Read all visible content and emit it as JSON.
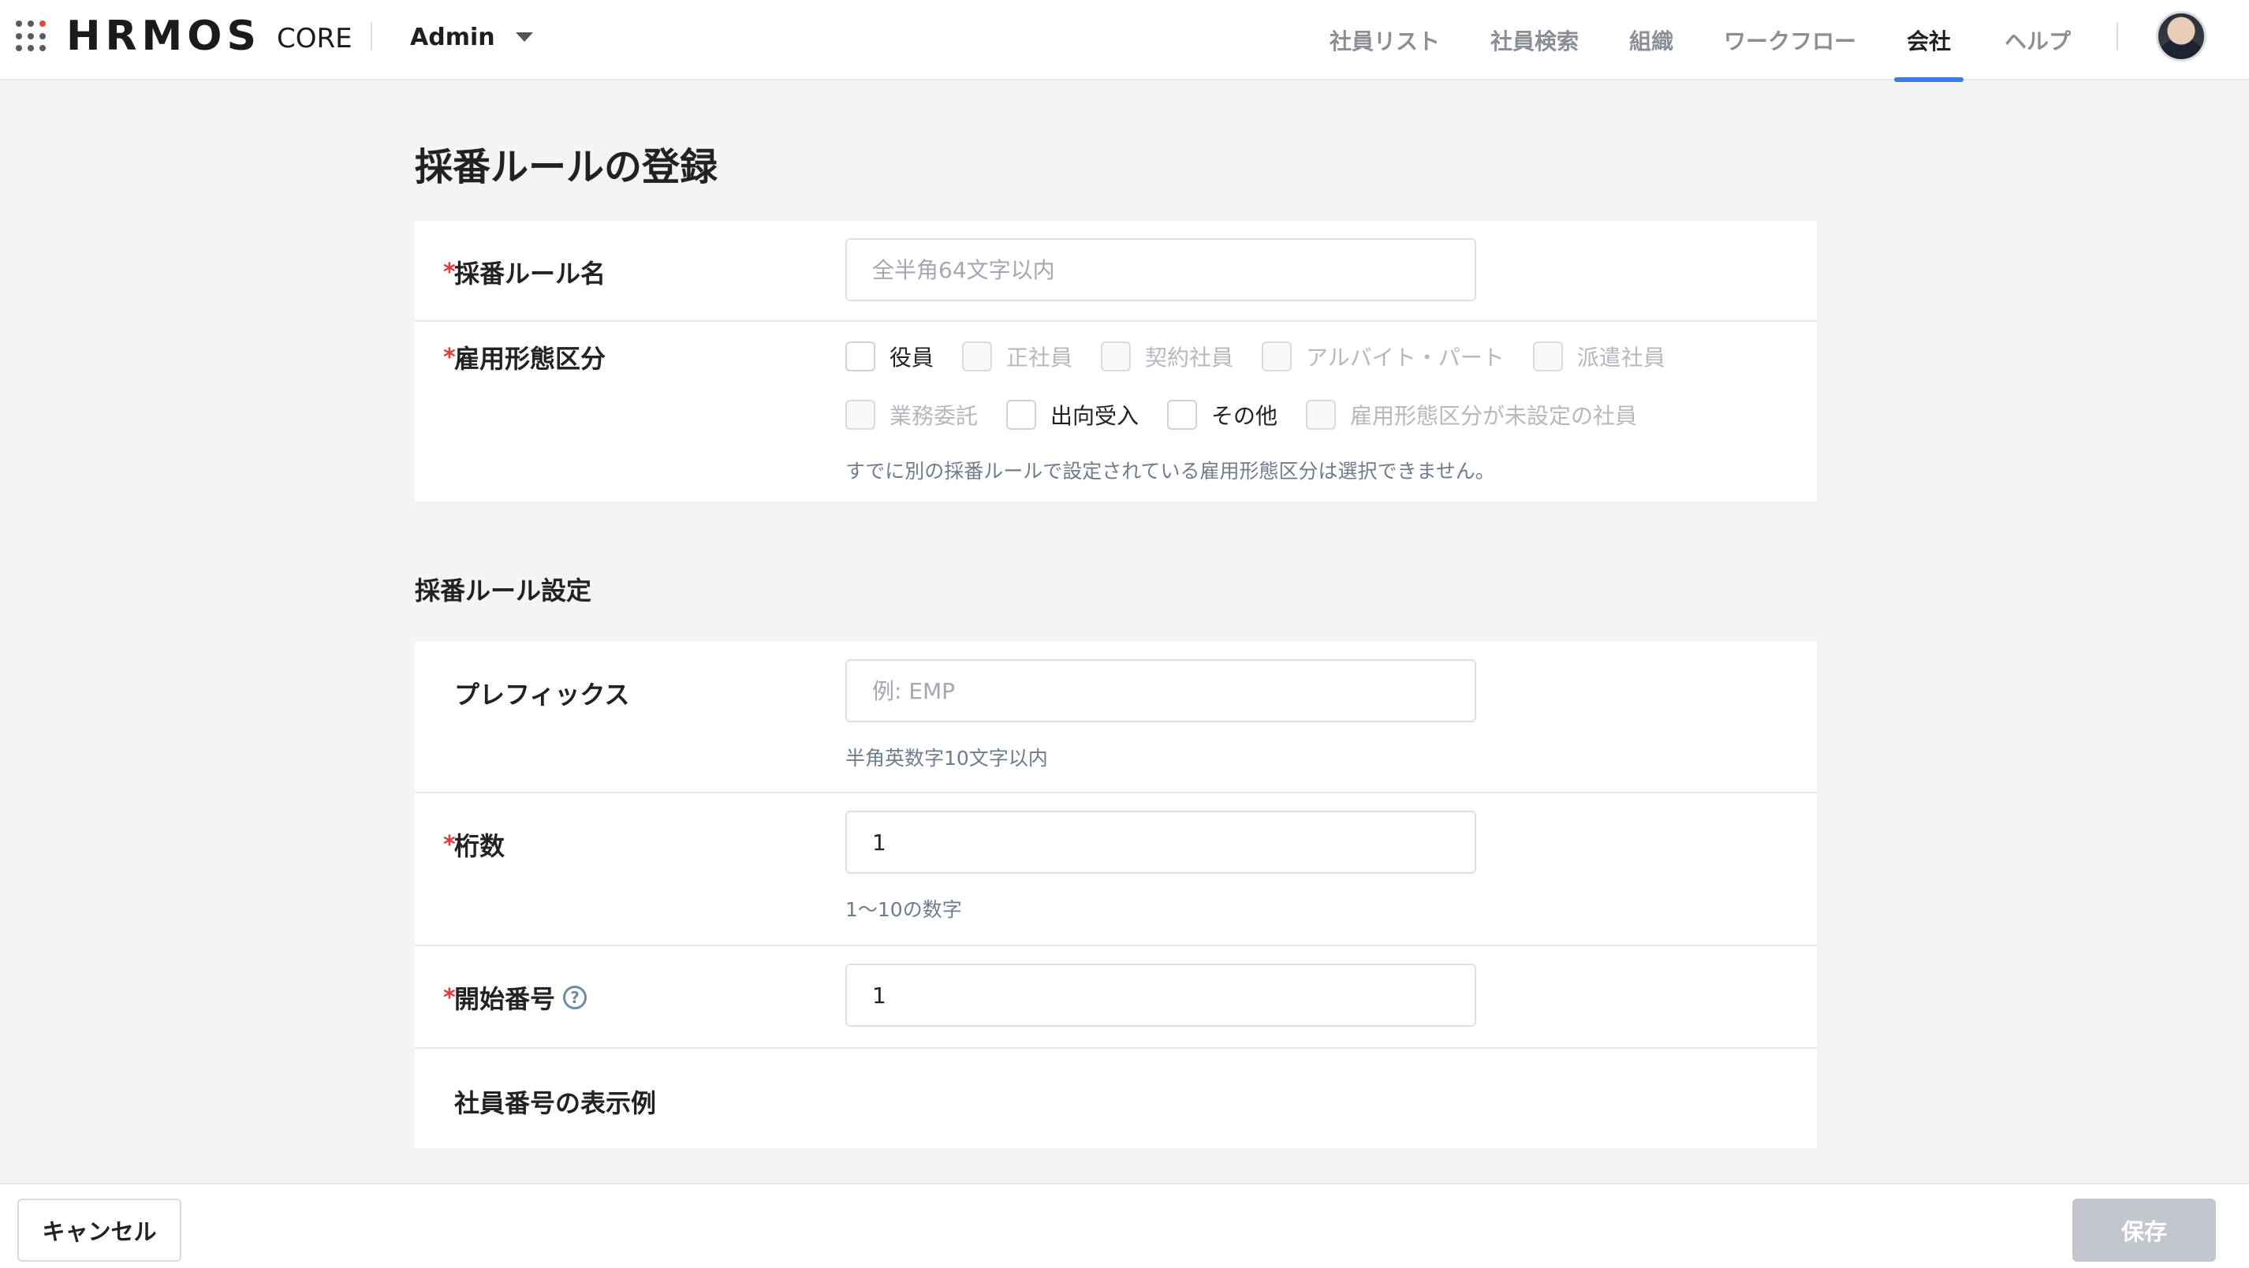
{
  "header": {
    "logo_text": "HRMOS",
    "logo_sub": "CORE",
    "account_label": "Admin",
    "nav": [
      {
        "label": "社員リスト"
      },
      {
        "label": "社員検索"
      },
      {
        "label": "組織"
      },
      {
        "label": "ワークフロー"
      },
      {
        "label": "会社",
        "active": true
      },
      {
        "label": "ヘルプ"
      }
    ],
    "active_color": "#3a7fe0"
  },
  "page": {
    "title": "採番ルールの登録"
  },
  "form_basic": {
    "rule_name": {
      "label": "採番ルール名",
      "required": true,
      "placeholder": "全半角64文字以内",
      "value": ""
    },
    "employment_type": {
      "label": "雇用形態区分",
      "required": true,
      "options": [
        {
          "label": "役員",
          "enabled": true,
          "checked": false
        },
        {
          "label": "正社員",
          "enabled": false,
          "checked": false
        },
        {
          "label": "契約社員",
          "enabled": false,
          "checked": false
        },
        {
          "label": "アルバイト・パート",
          "enabled": false,
          "checked": false
        },
        {
          "label": "派遣社員",
          "enabled": false,
          "checked": false
        },
        {
          "label": "業務委託",
          "enabled": false,
          "checked": false
        },
        {
          "label": "出向受入",
          "enabled": true,
          "checked": false
        },
        {
          "label": "その他",
          "enabled": true,
          "checked": false
        },
        {
          "label": "雇用形態区分が未設定の社員",
          "enabled": false,
          "checked": false
        }
      ],
      "note": "すでに別の採番ルールで設定されている雇用形態区分は選択できません。"
    }
  },
  "section_settings": {
    "title": "採番ルール設定",
    "prefix": {
      "label": "プレフィックス",
      "placeholder": "例: EMP",
      "value": "",
      "hint": "半角英数字10文字以内"
    },
    "digits": {
      "label": "桁数",
      "required": true,
      "value": "1",
      "hint": "1〜10の数字"
    },
    "start_number": {
      "label": "開始番号",
      "required": true,
      "value": "1",
      "help_icon": "question-circle-icon"
    },
    "preview": {
      "label": "社員番号の表示例"
    }
  },
  "footer": {
    "cancel_label": "キャンセル",
    "save_label": "保存"
  },
  "required_mark": "*",
  "help_glyph": "?"
}
